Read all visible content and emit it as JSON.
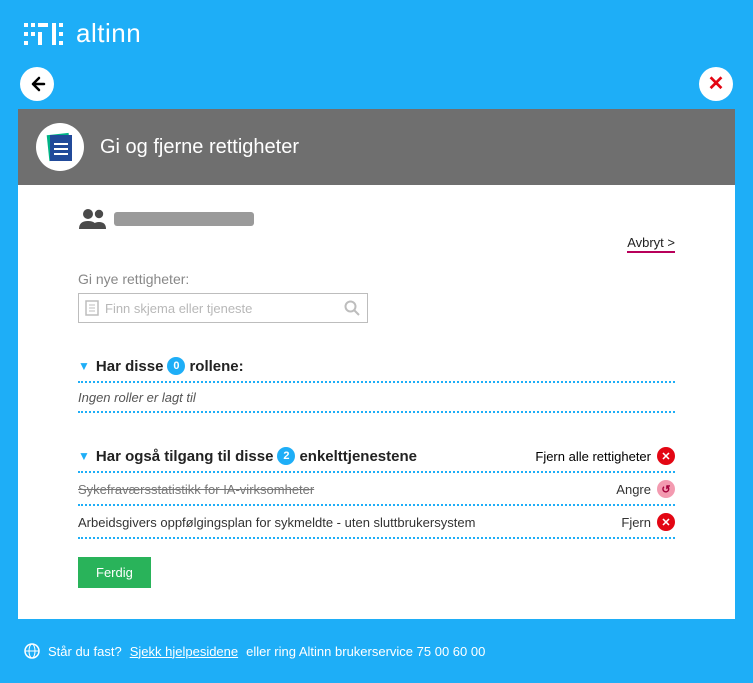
{
  "brand": "altinn",
  "pageTitle": "Gi og fjerne rettigheter",
  "abort": "Avbryt >",
  "newRightsLabel": "Gi nye rettigheter:",
  "search": {
    "placeholder": "Finn skjema eller tjeneste"
  },
  "roles": {
    "prefix": "Har disse",
    "count": "0",
    "suffix": "rollene:",
    "empty": "Ingen roller er lagt til"
  },
  "services": {
    "prefix": "Har også tilgang til disse",
    "count": "2",
    "suffix": "enkelttjenestene",
    "removeAll": "Fjern alle rettigheter",
    "items": [
      {
        "label": "Sykefraværsstatistikk for IA-virksomheter",
        "action": "Angre",
        "struck": true,
        "undo": true
      },
      {
        "label": "Arbeidsgivers oppfølgingsplan for sykmeldte - uten sluttbrukersystem",
        "action": "Fjern",
        "struck": false,
        "undo": false
      }
    ]
  },
  "done": "Ferdig",
  "footer": {
    "q": "Står du fast?",
    "link": "Sjekk hjelpesidene",
    "rest": "eller ring Altinn brukerservice 75 00 60 00"
  }
}
